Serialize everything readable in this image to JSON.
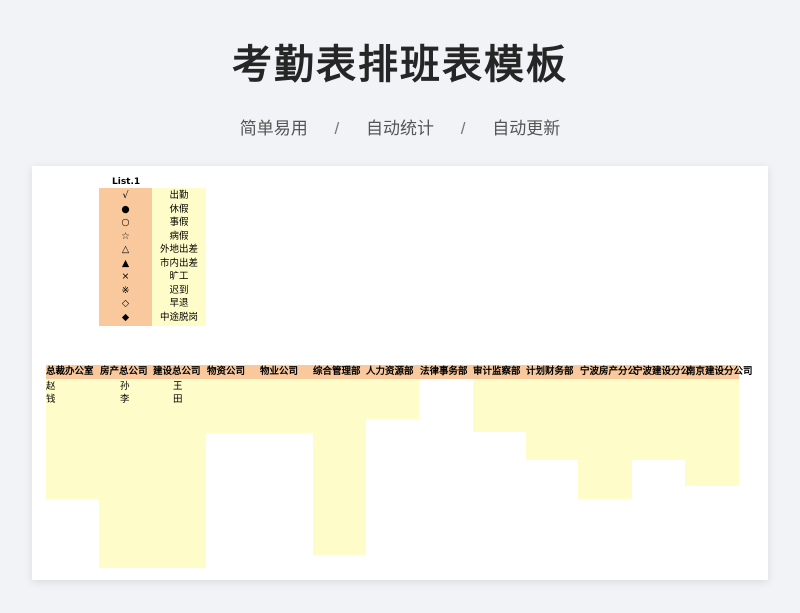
{
  "page": {
    "title": "考勤表排班表模板",
    "subtitle_items": [
      "简单易用",
      "自动统计",
      "自动更新"
    ],
    "subtitle_separator": "/"
  },
  "legend": {
    "title": "List.1",
    "items": [
      {
        "symbol": "√",
        "label": "出勤"
      },
      {
        "symbol": "●",
        "label": "休假"
      },
      {
        "symbol": "○",
        "label": "事假"
      },
      {
        "symbol": "☆",
        "label": "病假"
      },
      {
        "symbol": "△",
        "label": "外地出差"
      },
      {
        "symbol": "▲",
        "label": "市内出差"
      },
      {
        "symbol": "×",
        "label": "旷工"
      },
      {
        "symbol": "※",
        "label": "迟到"
      },
      {
        "symbol": "◇",
        "label": "早退"
      },
      {
        "symbol": "◆",
        "label": "中途脱岗"
      }
    ]
  },
  "departments": {
    "headers": [
      "总裁办公室",
      "房产总公司",
      "建设总公司",
      "物资公司",
      "物业公司",
      "综合管理部",
      "人力资源部",
      "法律事务部",
      "审计监察部",
      "计划财务部",
      "宁波房产分公",
      "宁波建设分公",
      "南京建设分公司"
    ],
    "rows": [
      [
        "赵",
        "孙",
        "王"
      ],
      [
        "钱",
        "李",
        "田"
      ]
    ]
  },
  "colors": {
    "header_fill": "#f9c99d",
    "list_fill": "#fefdc9",
    "background": "#f1f3f6"
  }
}
